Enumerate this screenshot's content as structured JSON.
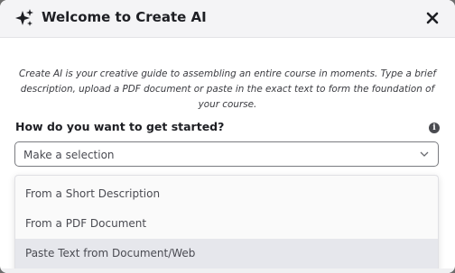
{
  "dialog": {
    "title": "Welcome to Create AI",
    "sparkle_icon": "sparkle-icon",
    "close_icon": "close-icon",
    "intro": "Create AI is your creative guide to assembling an entire course in moments. Type a brief description, upload a PDF document or paste in the exact text to form the foundation of your course.",
    "question": "How do you want to get started?",
    "info_icon": "info-icon",
    "info_glyph": "i",
    "select": {
      "value": "Make a selection",
      "chevron_icon": "chevron-down-icon"
    },
    "options": [
      {
        "label": "From a Short Description"
      },
      {
        "label": "From a PDF Document"
      },
      {
        "label": "Paste Text from Document/Web"
      }
    ]
  },
  "colors": {
    "header_bg": "#f4f4f6",
    "text_dark": "#1e1f24",
    "option_hover": "#e6e7ec"
  }
}
